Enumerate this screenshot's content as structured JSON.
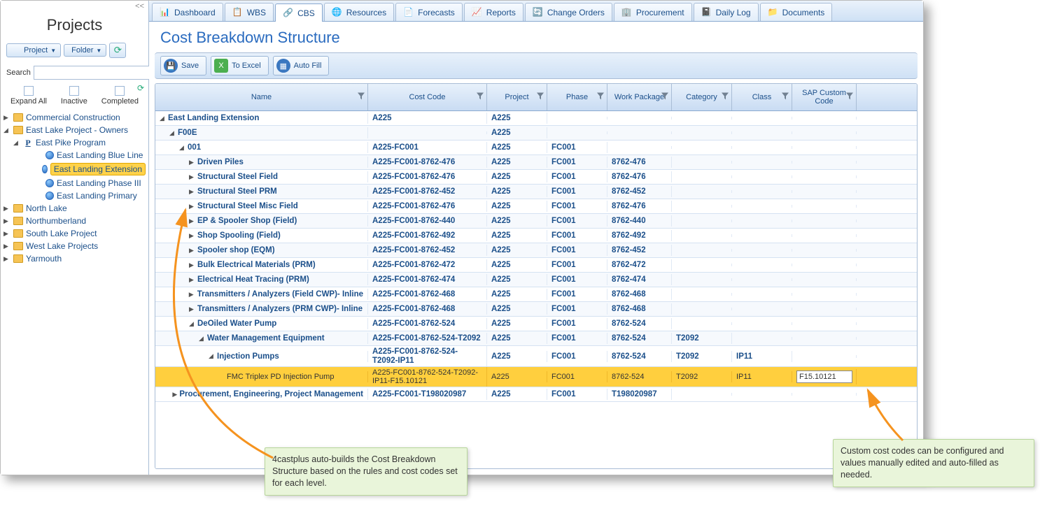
{
  "sidebar": {
    "collapse": "<<",
    "title": "Projects",
    "project_btn": "Project",
    "folder_btn": "Folder",
    "search_label": "Search",
    "filters": {
      "expand": "Expand All",
      "inactive": "Inactive",
      "completed": "Completed"
    },
    "tree": [
      {
        "label": "Commercial Construction",
        "indent": 0,
        "icon": "folder",
        "toggle": "▶"
      },
      {
        "label": "East Lake Project - Owners",
        "indent": 0,
        "icon": "folder",
        "toggle": "◢"
      },
      {
        "label": "East Pike Program",
        "indent": 1,
        "icon": "p",
        "toggle": "◢"
      },
      {
        "label": "East Landing Blue Line",
        "indent": 3,
        "icon": "globe",
        "toggle": ""
      },
      {
        "label": "East Landing Extension",
        "indent": 3,
        "icon": "globe",
        "toggle": "",
        "selected": true
      },
      {
        "label": "East Landing Phase III",
        "indent": 3,
        "icon": "globe",
        "toggle": ""
      },
      {
        "label": "East Landing Primary",
        "indent": 3,
        "icon": "globe",
        "toggle": ""
      },
      {
        "label": "North Lake",
        "indent": 0,
        "icon": "folder",
        "toggle": "▶"
      },
      {
        "label": "Northumberland",
        "indent": 0,
        "icon": "folder",
        "toggle": "▶"
      },
      {
        "label": "South Lake Project",
        "indent": 0,
        "icon": "folder",
        "toggle": "▶"
      },
      {
        "label": "West Lake Projects",
        "indent": 0,
        "icon": "folder",
        "toggle": "▶"
      },
      {
        "label": "Yarmouth",
        "indent": 0,
        "icon": "folder",
        "toggle": "▶"
      }
    ]
  },
  "tabs": [
    {
      "label": "Dashboard",
      "active": false
    },
    {
      "label": "WBS",
      "active": false
    },
    {
      "label": "CBS",
      "active": true
    },
    {
      "label": "Resources",
      "active": false
    },
    {
      "label": "Forecasts",
      "active": false
    },
    {
      "label": "Reports",
      "active": false
    },
    {
      "label": "Change Orders",
      "active": false
    },
    {
      "label": "Procurement",
      "active": false
    },
    {
      "label": "Daily Log",
      "active": false
    },
    {
      "label": "Documents",
      "active": false
    }
  ],
  "page_title": "Cost Breakdown Structure",
  "actions": {
    "save": "Save",
    "excel": "To Excel",
    "autofill": "Auto Fill"
  },
  "columns": {
    "name": "Name",
    "cost": "Cost Code",
    "proj": "Project",
    "phase": "Phase",
    "wp": "Work Package",
    "cat": "Category",
    "class": "Class",
    "sap": "SAP Custom Code"
  },
  "rows": [
    {
      "indent": 0,
      "toggle": "◢",
      "name": "East Landing Extension",
      "cost": "A225",
      "proj": "A225",
      "phase": "",
      "wp": "",
      "cat": "",
      "class": "",
      "sap": "",
      "bold": true
    },
    {
      "indent": 1,
      "toggle": "◢",
      "name": "F00E",
      "cost": "",
      "proj": "A225",
      "phase": "",
      "wp": "",
      "cat": "",
      "class": "",
      "sap": "",
      "bold": true
    },
    {
      "indent": 2,
      "toggle": "◢",
      "name": "001",
      "cost": "A225-FC001",
      "proj": "A225",
      "phase": "FC001",
      "wp": "",
      "cat": "",
      "class": "",
      "sap": "",
      "bold": true
    },
    {
      "indent": 3,
      "toggle": "▶",
      "name": "Driven Piles",
      "cost": "A225-FC001-8762-476",
      "proj": "A225",
      "phase": "FC001",
      "wp": "8762-476",
      "cat": "",
      "class": "",
      "sap": "",
      "bold": true
    },
    {
      "indent": 3,
      "toggle": "▶",
      "name": "Structural Steel Field",
      "cost": "A225-FC001-8762-476",
      "proj": "A225",
      "phase": "FC001",
      "wp": "8762-476",
      "cat": "",
      "class": "",
      "sap": "",
      "bold": true
    },
    {
      "indent": 3,
      "toggle": "▶",
      "name": "Structural Steel PRM",
      "cost": "A225-FC001-8762-452",
      "proj": "A225",
      "phase": "FC001",
      "wp": "8762-452",
      "cat": "",
      "class": "",
      "sap": "",
      "bold": true
    },
    {
      "indent": 3,
      "toggle": "▶",
      "name": "Structural Steel Misc Field",
      "cost": "A225-FC001-8762-476",
      "proj": "A225",
      "phase": "FC001",
      "wp": "8762-476",
      "cat": "",
      "class": "",
      "sap": "",
      "bold": true
    },
    {
      "indent": 3,
      "toggle": "▶",
      "name": "EP & Spooler Shop (Field)",
      "cost": "A225-FC001-8762-440",
      "proj": "A225",
      "phase": "FC001",
      "wp": "8762-440",
      "cat": "",
      "class": "",
      "sap": "",
      "bold": true
    },
    {
      "indent": 3,
      "toggle": "▶",
      "name": "Shop Spooling (Field)",
      "cost": "A225-FC001-8762-492",
      "proj": "A225",
      "phase": "FC001",
      "wp": "8762-492",
      "cat": "",
      "class": "",
      "sap": "",
      "bold": true
    },
    {
      "indent": 3,
      "toggle": "▶",
      "name": "Spooler shop (EQM)",
      "cost": "A225-FC001-8762-452",
      "proj": "A225",
      "phase": "FC001",
      "wp": "8762-452",
      "cat": "",
      "class": "",
      "sap": "",
      "bold": true
    },
    {
      "indent": 3,
      "toggle": "▶",
      "name": "Bulk Electrical Materials (PRM)",
      "cost": "A225-FC001-8762-472",
      "proj": "A225",
      "phase": "FC001",
      "wp": "8762-472",
      "cat": "",
      "class": "",
      "sap": "",
      "bold": true
    },
    {
      "indent": 3,
      "toggle": "▶",
      "name": "Electrical Heat Tracing (PRM)",
      "cost": "A225-FC001-8762-474",
      "proj": "A225",
      "phase": "FC001",
      "wp": "8762-474",
      "cat": "",
      "class": "",
      "sap": "",
      "bold": true
    },
    {
      "indent": 3,
      "toggle": "▶",
      "name": "Transmitters / Analyzers (Field CWP)- Inline",
      "cost": "A225-FC001-8762-468",
      "proj": "A225",
      "phase": "FC001",
      "wp": "8762-468",
      "cat": "",
      "class": "",
      "sap": "",
      "bold": true
    },
    {
      "indent": 3,
      "toggle": "▶",
      "name": "Transmitters / Analyzers (PRM CWP)- Inline",
      "cost": "A225-FC001-8762-468",
      "proj": "A225",
      "phase": "FC001",
      "wp": "8762-468",
      "cat": "",
      "class": "",
      "sap": "",
      "bold": true
    },
    {
      "indent": 3,
      "toggle": "◢",
      "name": "DeOiled Water Pump",
      "cost": "A225-FC001-8762-524",
      "proj": "A225",
      "phase": "FC001",
      "wp": "8762-524",
      "cat": "",
      "class": "",
      "sap": "",
      "bold": true
    },
    {
      "indent": 4,
      "toggle": "◢",
      "name": "Water Management Equipment",
      "cost": "A225-FC001-8762-524-T2092",
      "proj": "A225",
      "phase": "FC001",
      "wp": "8762-524",
      "cat": "T2092",
      "class": "",
      "sap": "",
      "bold": true
    },
    {
      "indent": 5,
      "toggle": "◢",
      "name": "Injection Pumps",
      "cost": "A225-FC001-8762-524-T2092-IP11",
      "proj": "A225",
      "phase": "FC001",
      "wp": "8762-524",
      "cat": "T2092",
      "class": "IP11",
      "sap": "",
      "bold": true
    },
    {
      "indent": 6,
      "toggle": "",
      "name": "FMC Triplex PD Injection Pump",
      "cost": "A225-FC001-8762-524-T2092-IP11-F15.10121",
      "proj": "A225",
      "phase": "FC001",
      "wp": "8762-524",
      "cat": "T2092",
      "class": "IP11",
      "sap": "F15.10121",
      "bold": false,
      "hl": true,
      "input": true
    },
    {
      "indent": 3,
      "toggle": "▶",
      "name": "Procurement, Engineering, Project Management",
      "cost": "A225-FC001-T198020987",
      "proj": "A225",
      "phase": "FC001",
      "wp": "T198020987",
      "cat": "",
      "class": "",
      "sap": "",
      "bold": true
    }
  ],
  "callout1": "4castplus auto-builds the Cost Breakdown Structure based on the rules and cost codes set for each level.",
  "callout2": "Custom cost codes can be configured and values manually edited and auto-filled as needed."
}
